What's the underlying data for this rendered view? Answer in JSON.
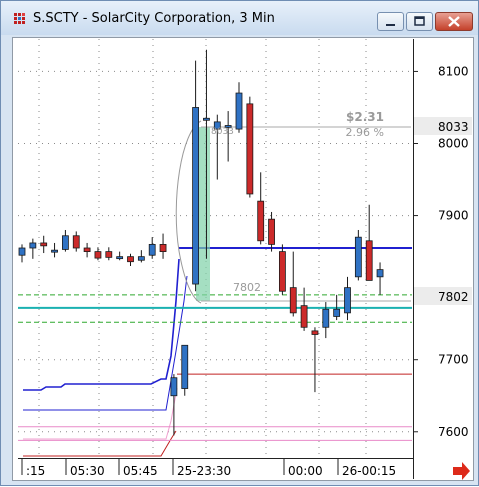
{
  "window": {
    "title": "S.SCTY - SolarCity Corporation, 3 Min",
    "controls": [
      "minimize",
      "maximize",
      "close"
    ]
  },
  "price_axis": {
    "ticks": [
      {
        "label": "8100",
        "value": 8100
      },
      {
        "label": "8000",
        "value": 8000
      },
      {
        "label": "7900",
        "value": 7900
      },
      {
        "label": "7700",
        "value": 7700
      },
      {
        "label": "7600",
        "value": 7600
      }
    ],
    "last_price_tag": {
      "label": "8033",
      "value": 8033
    },
    "current_price_tag": {
      "label": "7802",
      "value": 7802
    }
  },
  "time_axis": {
    "ticks": [
      ":15",
      "05:30",
      "05:45",
      "25-23:30",
      "00:00",
      "26-00:15"
    ]
  },
  "annotations": {
    "change_value": "$2.31",
    "change_percent": "2.96 %",
    "range_low_label": "7802",
    "range_high_label": "8033"
  },
  "colors": {
    "up_candle": "#2f72c4",
    "down_candle": "#cc2a2a",
    "blue_line": "#2020d0",
    "teal_line": "#1ab1b1",
    "green_dashed": "#2ea82e",
    "red_line": "#c02020",
    "pink_line": "#e88ac8",
    "highlight": "#7fd1a8"
  },
  "chart_data": {
    "type": "candlestick",
    "y_range": [
      7565,
      8145
    ],
    "candles": [
      {
        "o": 7845,
        "h": 7860,
        "l": 7835,
        "c": 7855
      },
      {
        "o": 7855,
        "h": 7868,
        "l": 7840,
        "c": 7862
      },
      {
        "o": 7862,
        "h": 7872,
        "l": 7848,
        "c": 7858
      },
      {
        "o": 7850,
        "h": 7862,
        "l": 7842,
        "c": 7852
      },
      {
        "o": 7853,
        "h": 7880,
        "l": 7850,
        "c": 7872
      },
      {
        "o": 7872,
        "h": 7878,
        "l": 7850,
        "c": 7855
      },
      {
        "o": 7855,
        "h": 7862,
        "l": 7842,
        "c": 7850
      },
      {
        "o": 7850,
        "h": 7856,
        "l": 7838,
        "c": 7841
      },
      {
        "o": 7850,
        "h": 7856,
        "l": 7838,
        "c": 7842
      },
      {
        "o": 7843,
        "h": 7850,
        "l": 7838,
        "c": 7843
      },
      {
        "o": 7843,
        "h": 7847,
        "l": 7830,
        "c": 7836
      },
      {
        "o": 7838,
        "h": 7852,
        "l": 7835,
        "c": 7843
      },
      {
        "o": 7845,
        "h": 7870,
        "l": 7840,
        "c": 7860
      },
      {
        "o": 7860,
        "h": 7875,
        "l": 7840,
        "c": 7850
      },
      {
        "o": 7650,
        "h": 7680,
        "l": 7595,
        "c": 7675
      },
      {
        "o": 7660,
        "h": 7720,
        "l": 7650,
        "c": 7720
      },
      {
        "o": 7805,
        "h": 8115,
        "l": 7795,
        "c": 8050
      },
      {
        "o": 8035,
        "h": 8130,
        "l": 7840,
        "c": 8035
      },
      {
        "o": 8020,
        "h": 8040,
        "l": 7950,
        "c": 8030
      },
      {
        "o": 8025,
        "h": 8045,
        "l": 7975,
        "c": 8025
      },
      {
        "o": 8020,
        "h": 8085,
        "l": 8015,
        "c": 8070
      },
      {
        "o": 8055,
        "h": 8065,
        "l": 7925,
        "c": 7930
      },
      {
        "o": 7920,
        "h": 7960,
        "l": 7860,
        "c": 7865
      },
      {
        "o": 7895,
        "h": 7905,
        "l": 7850,
        "c": 7860
      },
      {
        "o": 7850,
        "h": 7860,
        "l": 7790,
        "c": 7795
      },
      {
        "o": 7800,
        "h": 7850,
        "l": 7760,
        "c": 7765
      },
      {
        "o": 7775,
        "h": 7800,
        "l": 7740,
        "c": 7745
      },
      {
        "o": 7740,
        "h": 7745,
        "l": 7655,
        "c": 7735
      },
      {
        "o": 7745,
        "h": 7780,
        "l": 7730,
        "c": 7770
      },
      {
        "o": 7760,
        "h": 7790,
        "l": 7755,
        "c": 7770
      },
      {
        "o": 7765,
        "h": 7815,
        "l": 7755,
        "c": 7800
      },
      {
        "o": 7815,
        "h": 7880,
        "l": 7810,
        "c": 7870
      },
      {
        "o": 7865,
        "h": 7915,
        "l": 7810,
        "c": 7810
      },
      {
        "o": 7815,
        "h": 7835,
        "l": 7790,
        "c": 7825
      }
    ],
    "horizontal_lines": [
      {
        "name": "blue",
        "value": 7855
      },
      {
        "name": "teal",
        "value": 7772
      },
      {
        "name": "green-dashed-upper",
        "value": 7790
      },
      {
        "name": "green-dashed-lower",
        "value": 7752
      },
      {
        "name": "red",
        "value": 7680
      },
      {
        "name": "pink-upper",
        "value": 7607
      },
      {
        "name": "pink-lower",
        "value": 7588
      }
    ]
  }
}
